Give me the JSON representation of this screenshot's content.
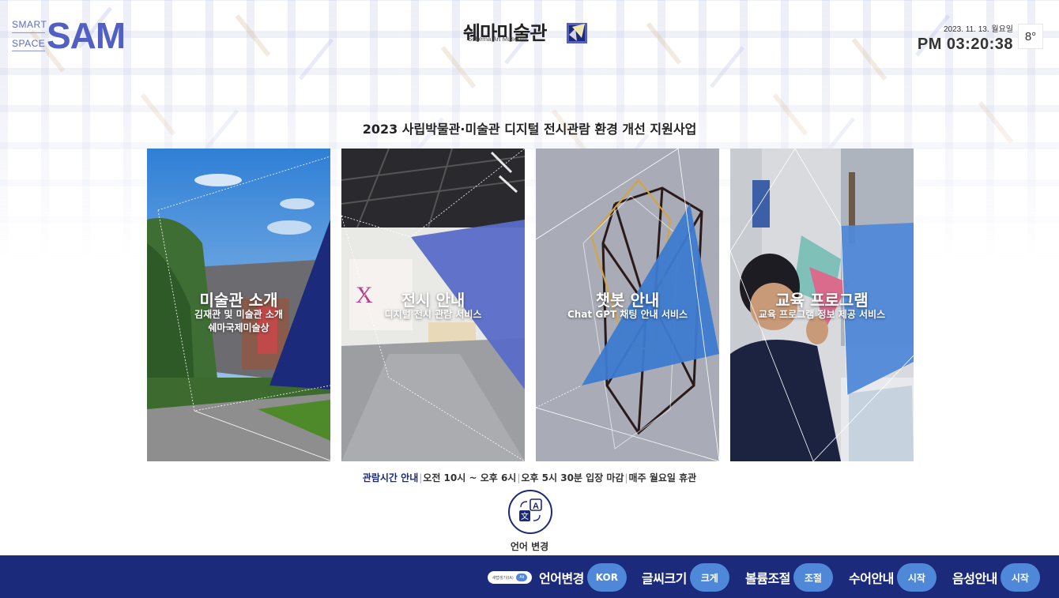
{
  "header": {
    "logo_small_1": "SMART",
    "logo_small_2": "SPACE",
    "logo_big": "SAM",
    "museum_name_kr": "쉐마미술관",
    "museum_name_en": "Schema Art Museum",
    "date": "2023. 11. 13. 월요일",
    "time": "PM 03:20:38",
    "temperature": "8°"
  },
  "headline": "2023 사립박물관·미술관 디지털 전시관람 환경 개선 지원사업",
  "cards": [
    {
      "title": "미술관 소개",
      "subtitle_1": "김재관 및 미술관 소개",
      "subtitle_2": "쉐마국제미술상"
    },
    {
      "title": "전시 안내",
      "subtitle_1": "디지털 전시 관람 서비스"
    },
    {
      "title": "챗봇 안내",
      "subtitle_1": "Chat GPT 채팅 안내 서비스"
    },
    {
      "title": "교육 프로그램",
      "subtitle_1": "교육 프로그램 정보 제공 서비스"
    }
  ],
  "hours": {
    "lead": "관람시간 안내",
    "items": [
      "오전 10시 ~ 오후 6시",
      "오후 5시 30분 입장 마감",
      "매주 월요일 휴관"
    ]
  },
  "language": {
    "label": "언어 변경",
    "icon": "translate-icon"
  },
  "footer": {
    "badge_text": "새탭생기(IA)",
    "badge_dot": "Alt",
    "items": [
      {
        "label": "언어변경",
        "button": "KOR"
      },
      {
        "label": "글씨크기",
        "button": "크게"
      },
      {
        "label": "볼륨조절",
        "button": "조절"
      },
      {
        "label": "수어안내",
        "button": "시작"
      },
      {
        "label": "음성안내",
        "button": "시작"
      }
    ]
  },
  "colors": {
    "navy": "#1b2a7a",
    "accent_blue": "#4f88d8",
    "logo_blue": "#5160c2"
  }
}
